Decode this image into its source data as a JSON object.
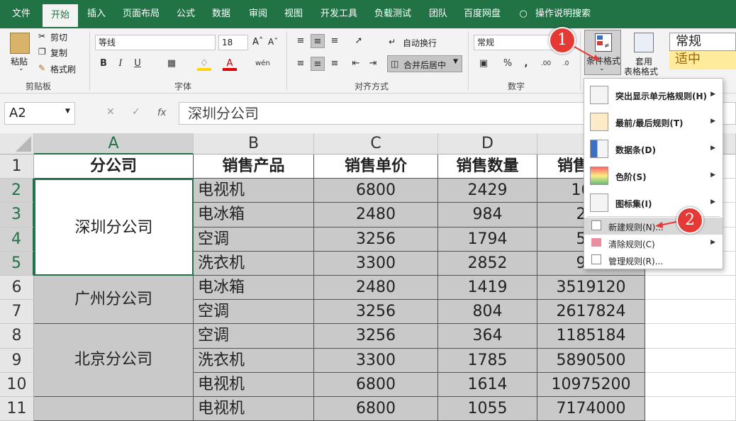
{
  "tabs": [
    "文件",
    "开始",
    "插入",
    "页面布局",
    "公式",
    "数据",
    "审阅",
    "视图",
    "开发工具",
    "负载测试",
    "团队",
    "百度网盘",
    "操作说明搜索"
  ],
  "ribbon": {
    "clipboard": {
      "paste": "粘贴",
      "cut": "剪切",
      "copy": "复制",
      "format_painter": "格式刷",
      "group": "剪贴板"
    },
    "font": {
      "name": "等线",
      "size": "18",
      "bold": "B",
      "italic": "I",
      "underline": "U",
      "group": "字体"
    },
    "align": {
      "wrap": "自动换行",
      "merge": "合并后居中",
      "group": "对齐方式"
    },
    "number": {
      "format": "常规",
      "percent": "%",
      "comma": ",",
      "group": "数字"
    },
    "styles": {
      "cond_format": "条件格式",
      "table_format_line1": "套用",
      "table_format_line2": "表格格式",
      "style_normal": "常规",
      "style_neutral": "适中"
    }
  },
  "formula_bar": {
    "name_box": "A2",
    "fx": "fx",
    "content": "深圳分公司"
  },
  "sheet": {
    "columns": [
      "A",
      "B",
      "C",
      "D",
      ""
    ],
    "rows": [
      "1",
      "2",
      "3",
      "4",
      "5",
      "6",
      "7",
      "8",
      "9",
      "10",
      "11"
    ],
    "headers": [
      "分公司",
      "销售产品",
      "销售单价",
      "销售数量",
      "销售"
    ],
    "branches": [
      "深圳分公司",
      "广州分公司",
      "北京分公司"
    ],
    "data": [
      [
        "电视机",
        "6800",
        "2429",
        "1651"
      ],
      [
        "电冰箱",
        "2480",
        "984",
        "244"
      ],
      [
        "空调",
        "3256",
        "1794",
        "584"
      ],
      [
        "洗衣机",
        "3300",
        "2852",
        "941"
      ],
      [
        "电冰箱",
        "2480",
        "1419",
        "3519120"
      ],
      [
        "空调",
        "3256",
        "804",
        "2617824"
      ],
      [
        "空调",
        "3256",
        "364",
        "1185184"
      ],
      [
        "洗衣机",
        "3300",
        "1785",
        "5890500"
      ],
      [
        "电视机",
        "6800",
        "1614",
        "10975200"
      ],
      [
        "电视机",
        "6800",
        "1055",
        "7174000"
      ]
    ]
  },
  "menu": {
    "items": [
      "突出显示单元格规则(H)",
      "最前/最后规则(T)",
      "数据条(D)",
      "色阶(S)",
      "图标集(I)",
      "新建规则(N)...",
      "清除规则(C)",
      "管理规则(R)..."
    ]
  },
  "annotations": {
    "step1": "1",
    "step2": "2"
  },
  "colors": {
    "accent": "#217346",
    "badge": "#e53935",
    "selection": "#c9c9c9"
  }
}
